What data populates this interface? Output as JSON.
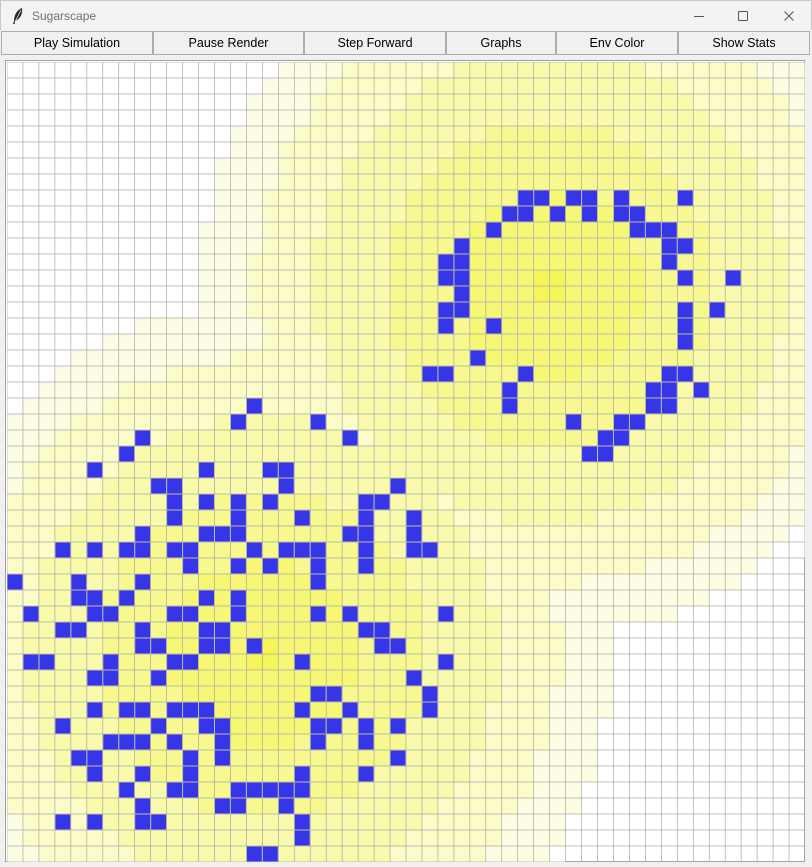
{
  "window": {
    "title": "Sugarscape",
    "icon": "feather-icon"
  },
  "window_controls": [
    "minimize-icon",
    "maximize-icon",
    "close-icon"
  ],
  "toolbar": {
    "buttons": [
      "Play Simulation",
      "Pause Render",
      "Step Forward",
      "Graphs",
      "Env Color",
      "Show Stats"
    ]
  },
  "colors": {
    "agent": "#3636e8",
    "sugar_max": "#f5f55a",
    "empty": "#ffffff",
    "grid_line": "#a8a8a8"
  },
  "grid": {
    "cols": 50,
    "rows": 50,
    "agents": [
      [
        32,
        8
      ],
      [
        33,
        8
      ],
      [
        35,
        8
      ],
      [
        36,
        8
      ],
      [
        38,
        8
      ],
      [
        42,
        8
      ],
      [
        31,
        9
      ],
      [
        32,
        9
      ],
      [
        34,
        9
      ],
      [
        36,
        9
      ],
      [
        38,
        9
      ],
      [
        39,
        9
      ],
      [
        30,
        10
      ],
      [
        39,
        10
      ],
      [
        40,
        10
      ],
      [
        41,
        10
      ],
      [
        28,
        11
      ],
      [
        41,
        11
      ],
      [
        42,
        11
      ],
      [
        27,
        12
      ],
      [
        28,
        12
      ],
      [
        41,
        12
      ],
      [
        27,
        13
      ],
      [
        28,
        13
      ],
      [
        42,
        13
      ],
      [
        45,
        13
      ],
      [
        28,
        14
      ],
      [
        27,
        15
      ],
      [
        28,
        15
      ],
      [
        42,
        15
      ],
      [
        44,
        15
      ],
      [
        27,
        16
      ],
      [
        30,
        16
      ],
      [
        42,
        16
      ],
      [
        42,
        17
      ],
      [
        29,
        18
      ],
      [
        26,
        19
      ],
      [
        27,
        19
      ],
      [
        32,
        19
      ],
      [
        41,
        19
      ],
      [
        42,
        19
      ],
      [
        31,
        20
      ],
      [
        40,
        20
      ],
      [
        41,
        20
      ],
      [
        43,
        20
      ],
      [
        15,
        21
      ],
      [
        31,
        21
      ],
      [
        40,
        21
      ],
      [
        41,
        21
      ],
      [
        14,
        22
      ],
      [
        19,
        22
      ],
      [
        35,
        22
      ],
      [
        38,
        22
      ],
      [
        39,
        22
      ],
      [
        8,
        23
      ],
      [
        21,
        23
      ],
      [
        37,
        23
      ],
      [
        38,
        23
      ],
      [
        7,
        24
      ],
      [
        36,
        24
      ],
      [
        37,
        24
      ],
      [
        5,
        25
      ],
      [
        12,
        25
      ],
      [
        16,
        25
      ],
      [
        17,
        25
      ],
      [
        9,
        26
      ],
      [
        10,
        26
      ],
      [
        17,
        26
      ],
      [
        24,
        26
      ],
      [
        10,
        27
      ],
      [
        12,
        27
      ],
      [
        14,
        27
      ],
      [
        16,
        27
      ],
      [
        22,
        27
      ],
      [
        23,
        27
      ],
      [
        10,
        28
      ],
      [
        14,
        28
      ],
      [
        18,
        28
      ],
      [
        22,
        28
      ],
      [
        25,
        28
      ],
      [
        8,
        29
      ],
      [
        12,
        29
      ],
      [
        13,
        29
      ],
      [
        14,
        29
      ],
      [
        21,
        29
      ],
      [
        22,
        29
      ],
      [
        25,
        29
      ],
      [
        3,
        30
      ],
      [
        5,
        30
      ],
      [
        7,
        30
      ],
      [
        8,
        30
      ],
      [
        10,
        30
      ],
      [
        11,
        30
      ],
      [
        15,
        30
      ],
      [
        17,
        30
      ],
      [
        18,
        30
      ],
      [
        19,
        30
      ],
      [
        22,
        30
      ],
      [
        25,
        30
      ],
      [
        26,
        30
      ],
      [
        11,
        31
      ],
      [
        14,
        31
      ],
      [
        16,
        31
      ],
      [
        19,
        31
      ],
      [
        22,
        31
      ],
      [
        0,
        32
      ],
      [
        4,
        32
      ],
      [
        8,
        32
      ],
      [
        19,
        32
      ],
      [
        4,
        33
      ],
      [
        5,
        33
      ],
      [
        7,
        33
      ],
      [
        12,
        33
      ],
      [
        14,
        33
      ],
      [
        1,
        34
      ],
      [
        5,
        34
      ],
      [
        6,
        34
      ],
      [
        10,
        34
      ],
      [
        11,
        34
      ],
      [
        14,
        34
      ],
      [
        19,
        34
      ],
      [
        21,
        34
      ],
      [
        27,
        34
      ],
      [
        3,
        35
      ],
      [
        4,
        35
      ],
      [
        8,
        35
      ],
      [
        12,
        35
      ],
      [
        13,
        35
      ],
      [
        22,
        35
      ],
      [
        23,
        35
      ],
      [
        8,
        36
      ],
      [
        9,
        36
      ],
      [
        12,
        36
      ],
      [
        13,
        36
      ],
      [
        15,
        36
      ],
      [
        23,
        36
      ],
      [
        24,
        36
      ],
      [
        1,
        37
      ],
      [
        2,
        37
      ],
      [
        6,
        37
      ],
      [
        10,
        37
      ],
      [
        11,
        37
      ],
      [
        18,
        37
      ],
      [
        27,
        37
      ],
      [
        5,
        38
      ],
      [
        6,
        38
      ],
      [
        9,
        38
      ],
      [
        25,
        38
      ],
      [
        19,
        39
      ],
      [
        20,
        39
      ],
      [
        26,
        39
      ],
      [
        5,
        40
      ],
      [
        7,
        40
      ],
      [
        8,
        40
      ],
      [
        10,
        40
      ],
      [
        11,
        40
      ],
      [
        12,
        40
      ],
      [
        18,
        40
      ],
      [
        21,
        40
      ],
      [
        26,
        40
      ],
      [
        3,
        41
      ],
      [
        9,
        41
      ],
      [
        12,
        41
      ],
      [
        13,
        41
      ],
      [
        19,
        41
      ],
      [
        20,
        41
      ],
      [
        22,
        41
      ],
      [
        24,
        41
      ],
      [
        6,
        42
      ],
      [
        7,
        42
      ],
      [
        8,
        42
      ],
      [
        10,
        42
      ],
      [
        13,
        42
      ],
      [
        19,
        42
      ],
      [
        22,
        42
      ],
      [
        4,
        43
      ],
      [
        5,
        43
      ],
      [
        11,
        43
      ],
      [
        13,
        43
      ],
      [
        24,
        43
      ],
      [
        5,
        44
      ],
      [
        8,
        44
      ],
      [
        11,
        44
      ],
      [
        18,
        44
      ],
      [
        22,
        44
      ],
      [
        7,
        45
      ],
      [
        10,
        45
      ],
      [
        11,
        45
      ],
      [
        14,
        45
      ],
      [
        15,
        45
      ],
      [
        16,
        45
      ],
      [
        17,
        45
      ],
      [
        18,
        45
      ],
      [
        8,
        46
      ],
      [
        13,
        46
      ],
      [
        14,
        46
      ],
      [
        17,
        46
      ],
      [
        3,
        47
      ],
      [
        5,
        47
      ],
      [
        8,
        47
      ],
      [
        9,
        47
      ],
      [
        18,
        47
      ],
      [
        18,
        48
      ],
      [
        15,
        49
      ],
      [
        16,
        49
      ]
    ]
  }
}
